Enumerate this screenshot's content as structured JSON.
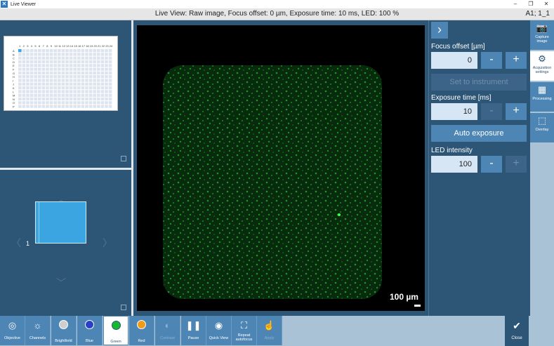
{
  "window": {
    "title": "Live Viewer",
    "controls": [
      "–",
      "❐",
      "✕"
    ]
  },
  "infobar": {
    "text": "Live View: Raw image, Focus offset: 0 µm, Exposure time: 10 ms, LED: 100 %",
    "well": "A1; 1_1"
  },
  "plate": {
    "columns": [
      "1",
      "2",
      "3",
      "4",
      "5",
      "6",
      "7",
      "8",
      "9",
      "10",
      "11",
      "12",
      "13",
      "14",
      "15",
      "16",
      "17",
      "18",
      "19",
      "20",
      "21",
      "22",
      "23",
      "24"
    ],
    "rows": [
      "A",
      "B",
      "C",
      "D",
      "E",
      "F",
      "G",
      "H",
      "I",
      "J",
      "K",
      "L",
      "M",
      "N",
      "O",
      "P"
    ],
    "selected_well": "A1"
  },
  "fov": {
    "column_label": "1",
    "row_label": "1"
  },
  "viewer": {
    "scale_label": "100 µm"
  },
  "acquisition": {
    "focus_label": "Focus offset [µm]",
    "focus_value": "0",
    "set_instrument": "Set to instrument",
    "exposure_label": "Exposure time [ms]",
    "exposure_value": "10",
    "auto_exposure": "Auto exposure",
    "led_label": "LED intensity",
    "led_value": "100",
    "minus": "-",
    "plus": "+"
  },
  "side_tabs": [
    {
      "label": "Capture image",
      "icon": "camera-icon"
    },
    {
      "label": "Acquisition settings",
      "icon": "camera-settings-icon"
    },
    {
      "label": "Processing",
      "icon": "processing-icon"
    },
    {
      "label": "Overlay",
      "icon": "overlay-icon"
    }
  ],
  "toolbar": {
    "objective": "Objective",
    "channels": "Channels",
    "brightfield": "Brightfield",
    "blue": "Blue",
    "green": "Green",
    "red": "Red",
    "contrast": "Contrast",
    "pause": "Pause",
    "quick_view": "Quick View",
    "repeat_autofocus": "Repeat autofocus",
    "apply": "Apply",
    "close": "Close"
  },
  "colors": {
    "accent": "#4d86b4",
    "panel": "#2d5575",
    "selected_well": "#3aa5e0",
    "channel_blue": "#2a3fc8",
    "channel_green": "#16b832",
    "channel_red": "#f29a1a",
    "channel_brightfield": "#cfcfcf"
  }
}
